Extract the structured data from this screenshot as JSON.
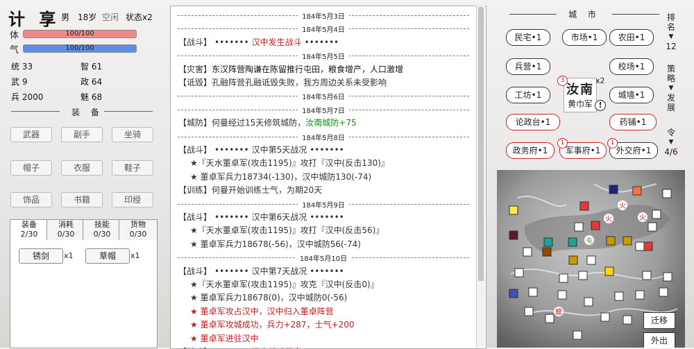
{
  "character": {
    "name": "计 享",
    "gender": "男",
    "age": "18岁",
    "status": "空闲",
    "state_count": "状态x2",
    "hp_label": "体",
    "hp_text": "100/100",
    "hp_fraction": 1.0,
    "mp_label": "气",
    "mp_text": "100/100",
    "mp_fraction": 1.0,
    "hp_color": "#f08a8a",
    "mp_color": "#5b8fe6",
    "stats": [
      {
        "label": "统",
        "value": "33"
      },
      {
        "label": "智",
        "value": "61"
      },
      {
        "label": "武",
        "value": "9"
      },
      {
        "label": "政",
        "value": "64"
      },
      {
        "label": "兵",
        "value": "2000"
      },
      {
        "label": "魅",
        "value": "68"
      }
    ]
  },
  "equipment": {
    "title": "装 备",
    "slots": [
      "武器",
      "副手",
      "坐骑",
      "帽子",
      "衣服",
      "鞋子",
      "饰品",
      "书籍",
      "印绶"
    ]
  },
  "inventory": {
    "tabs": [
      {
        "label": "装备",
        "count": "2/30"
      },
      {
        "label": "消耗",
        "count": "0/30"
      },
      {
        "label": "技能",
        "count": "0/30"
      },
      {
        "label": "货物",
        "count": "0/30"
      }
    ],
    "items": [
      {
        "name": "锈剑",
        "count": "x1"
      },
      {
        "name": "草帽",
        "count": "x1"
      }
    ]
  },
  "log": [
    {
      "type": "date",
      "text": "184年5月3日"
    },
    {
      "type": "date",
      "text": "184年5月4日"
    },
    {
      "type": "event",
      "tag": "【战斗】",
      "dots": "•••••••",
      "body": "汉中发生战斗",
      "color": "red",
      "tail": "•••••••"
    },
    {
      "type": "date",
      "text": "184年5月5日"
    },
    {
      "type": "event",
      "tag": "【灾害】",
      "body": "东汉阵营陶谦在陈留推行屯田，粮食增产，人口激增",
      "color": "dk"
    },
    {
      "type": "event",
      "tag": "【诋毁】",
      "body": "孔融阵营孔融诋毁失败，我方周边关系未受影响",
      "color": ""
    },
    {
      "type": "date",
      "text": "184年5月6日"
    },
    {
      "type": "date",
      "text": "184年5月7日"
    },
    {
      "type": "event",
      "tag": "【城防】",
      "body": "何曼经过15天修筑城防，",
      "extra": "汝南城防+75",
      "extra_color": "grn"
    },
    {
      "type": "date",
      "text": "184年5月8日"
    },
    {
      "type": "event",
      "tag": "【战斗】",
      "dots": "•••••••",
      "body": "汉中第5天战况",
      "tail": "•••••••"
    },
    {
      "type": "sub",
      "text": "★『天水董卓军(攻击1195)』攻打『汉中(反击130)』"
    },
    {
      "type": "sub",
      "text": "★ 董卓军兵力18734(-130)，汉中城防130(-74)"
    },
    {
      "type": "event",
      "tag": "【训练】",
      "body": "何曼开始训练士气，为期20天"
    },
    {
      "type": "date",
      "text": "184年5月9日"
    },
    {
      "type": "event",
      "tag": "【战斗】",
      "dots": "•••••••",
      "body": "汉中第6天战况",
      "tail": "•••••••"
    },
    {
      "type": "sub",
      "text": "★『天水董卓军(攻击1195)』攻打『汉中(反击56)』"
    },
    {
      "type": "sub",
      "text": "★ 董卓军兵力18678(-56)，汉中城防56(-74)"
    },
    {
      "type": "date",
      "text": "184年5月10日"
    },
    {
      "type": "event",
      "tag": "【战斗】",
      "dots": "•••••••",
      "body": "汉中第7天战况",
      "tail": "•••••••"
    },
    {
      "type": "sub",
      "text": "★『天水董卓军(攻击1195)』攻克『汉中(反击0)』"
    },
    {
      "type": "sub",
      "text": "★ 董卓军兵力18678(0)，汉中城防0(-56)"
    },
    {
      "type": "sub",
      "text": "★ 董卓军攻占汉中，汉中归入董卓阵营",
      "color": "red"
    },
    {
      "type": "sub",
      "text": "★ 董卓军攻城成功，兵力+287，士气+200",
      "color": "red"
    },
    {
      "type": "sub",
      "text": "★ 董卓军进驻汉中",
      "color": "red"
    },
    {
      "type": "event",
      "tag": "【战斗】",
      "dots": "•••••••",
      "body": "汉中战斗平息",
      "color": "red",
      "tail": "•••••••"
    }
  ],
  "city": {
    "title": "城 市",
    "name": "汝南",
    "faction": "黄巾军",
    "badge_left": "3",
    "badge_right": "x2",
    "alert_icon": "exclamation-icon",
    "buildings": [
      {
        "label": "民宅•1",
        "red": false
      },
      {
        "label": "市场•1",
        "red": false
      },
      {
        "label": "农田•1",
        "red": false
      },
      {
        "label": "兵营•1",
        "red": false
      },
      {
        "label": "校场•1",
        "red": false
      },
      {
        "label": "工坊•1",
        "red": false
      },
      {
        "label": "城墙•1",
        "red": false
      },
      {
        "label": "论政台•1",
        "red": true
      },
      {
        "label": "药铺•1",
        "red": true
      },
      {
        "label": "政务府•1",
        "red": true
      },
      {
        "label": "军事府•1",
        "red": true,
        "badge": "1"
      },
      {
        "label": "外交府•1",
        "red": false,
        "badge": "1"
      }
    ]
  },
  "sidebar": {
    "rank_label": "排名",
    "rank_value": "12",
    "strategy_label": "策略",
    "strategy_value": "发展",
    "order_label": "令",
    "order_value": "4/6"
  },
  "map": {
    "markers": {
      "fire": "火",
      "tun": "屯",
      "locust": "蝗"
    },
    "buttons": [
      "迁移",
      "外出"
    ]
  }
}
